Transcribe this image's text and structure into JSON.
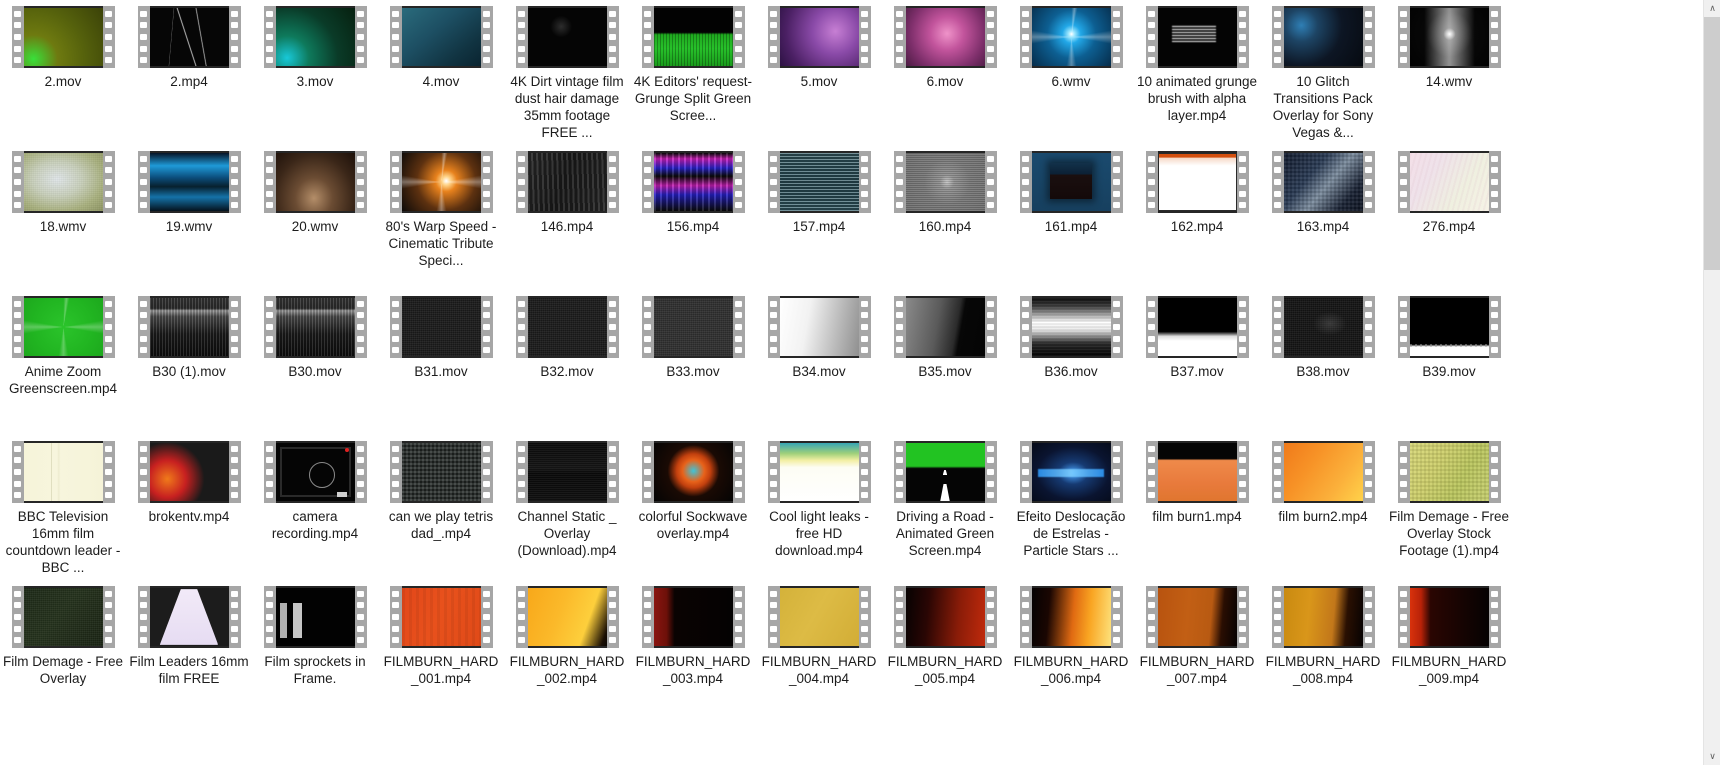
{
  "view": {
    "type": "file-explorer-grid",
    "columns": 13,
    "scrollbar": {
      "up_arrow": "∧",
      "down_arrow": "∨"
    }
  },
  "files": [
    {
      "name": "2.mov",
      "style": "olive-green-corner"
    },
    {
      "name": "2.mp4",
      "style": "black-scratches"
    },
    {
      "name": "3.mov",
      "style": "dark-green-cyan"
    },
    {
      "name": "4.mov",
      "style": "teal-blue-fade"
    },
    {
      "name": "4K Dirt vintage film dust hair damage 35mm footage FREE ...",
      "style": "near-black"
    },
    {
      "name": "4K Editors' request-Grunge Split Green Scree...",
      "style": "green-waveform"
    },
    {
      "name": "5.mov",
      "style": "purple-magenta"
    },
    {
      "name": "6.mov",
      "style": "magenta-pink"
    },
    {
      "name": "6.wmv",
      "style": "blue-starburst"
    },
    {
      "name": "10 animated grunge brush with alpha layer.mp4",
      "style": "white-brush-black"
    },
    {
      "name": "10 Glitch Transitions Pack Overlay for Sony Vegas &...",
      "style": "dark-rainbow-bokeh"
    },
    {
      "name": "14.wmv",
      "style": "white-flare-black"
    },
    {
      "name": "18.wmv",
      "style": "grunge-cream"
    },
    {
      "name": "19.wmv",
      "style": "blue-bands"
    },
    {
      "name": "20.wmv",
      "style": "brown-dark"
    },
    {
      "name": "80's Warp Speed - Cinematic Tribute Speci...",
      "style": "orange-starburst"
    },
    {
      "name": "146.mp4",
      "style": "dark-grey-grunge"
    },
    {
      "name": "156.mp4",
      "style": "magenta-glitch"
    },
    {
      "name": "157.mp4",
      "style": "teal-scanlines"
    },
    {
      "name": "160.mp4",
      "style": "grey-grain-dot"
    },
    {
      "name": "161.mp4",
      "style": "navy-screen"
    },
    {
      "name": "162.mp4",
      "style": "white-page-orange-bar"
    },
    {
      "name": "163.mp4",
      "style": "dark-blue-texture"
    },
    {
      "name": "276.mp4",
      "style": "pastel-pink"
    },
    {
      "name": "Anime Zoom Greenscreen.mp4",
      "style": "bright-green-burst"
    },
    {
      "name": "B30 (1).mov",
      "style": "grey-spectrogram"
    },
    {
      "name": "B30.mov",
      "style": "grey-spectrogram"
    },
    {
      "name": "B31.mov",
      "style": "black-grain"
    },
    {
      "name": "B32.mov",
      "style": "black-grain"
    },
    {
      "name": "B33.mov",
      "style": "dark-grain-light"
    },
    {
      "name": "B34.mov",
      "style": "white-to-grey"
    },
    {
      "name": "B35.mov",
      "style": "grey-diagonal-black"
    },
    {
      "name": "B36.mov",
      "style": "white-streak-black"
    },
    {
      "name": "B37.mov",
      "style": "black-top-white-bottom"
    },
    {
      "name": "B38.mov",
      "style": "very-dark-grain"
    },
    {
      "name": "B39.mov",
      "style": "black-white-strip"
    },
    {
      "name": "BBC Television 16mm film countdown leader - BBC ...",
      "style": "cream-leader"
    },
    {
      "name": "brokentv.mp4",
      "style": "color-bokeh"
    },
    {
      "name": "camera recording.mp4",
      "style": "black-rec-circle"
    },
    {
      "name": "can we play tetris dad_.mp4",
      "style": "dark-mosaic"
    },
    {
      "name": "Channel Static _ Overlay (Download).mp4",
      "style": "near-black-static"
    },
    {
      "name": "colorful Sockwave overlay.mp4",
      "style": "black-orange-blob"
    },
    {
      "name": "Cool light leaks - free HD download.mp4",
      "style": "white-top-gradient"
    },
    {
      "name": "Driving a Road - Animated Green Screen.mp4",
      "style": "green-road"
    },
    {
      "name": "Efeito Deslocação de Estrelas - Particle Stars ...",
      "style": "blue-stars-text"
    },
    {
      "name": "film burn1.mp4",
      "style": "orange-black-top"
    },
    {
      "name": "film burn2.mp4",
      "style": "orange-bright"
    },
    {
      "name": "Film Demage - Free Overlay Stock Footage (1).mp4",
      "style": "yellow-green-grunge"
    },
    {
      "name": "Film Demage - Free Overlay",
      "style": "dark-green-grunge"
    },
    {
      "name": "Film Leaders 16mm film FREE",
      "style": "white-cone-black"
    },
    {
      "name": "Film sprockets in Frame.",
      "style": "black-sprocket-text"
    },
    {
      "name": "FILMBURN_HARD_001.mp4",
      "style": "red-orange-flat"
    },
    {
      "name": "FILMBURN_HARD_002.mp4",
      "style": "amber-bright"
    },
    {
      "name": "FILMBURN_HARD_003.mp4",
      "style": "dark-red-left"
    },
    {
      "name": "FILMBURN_HARD_004.mp4",
      "style": "mustard-flat"
    },
    {
      "name": "FILMBURN_HARD_005.mp4",
      "style": "black-to-red"
    },
    {
      "name": "FILMBURN_HARD_006.mp4",
      "style": "black-to-amber"
    },
    {
      "name": "FILMBURN_HARD_007.mp4",
      "style": "orange-brown-right-black"
    },
    {
      "name": "FILMBURN_HARD_008.mp4",
      "style": "amber-right-black"
    },
    {
      "name": "FILMBURN_HARD_009.mp4",
      "style": "red-left-black"
    }
  ]
}
